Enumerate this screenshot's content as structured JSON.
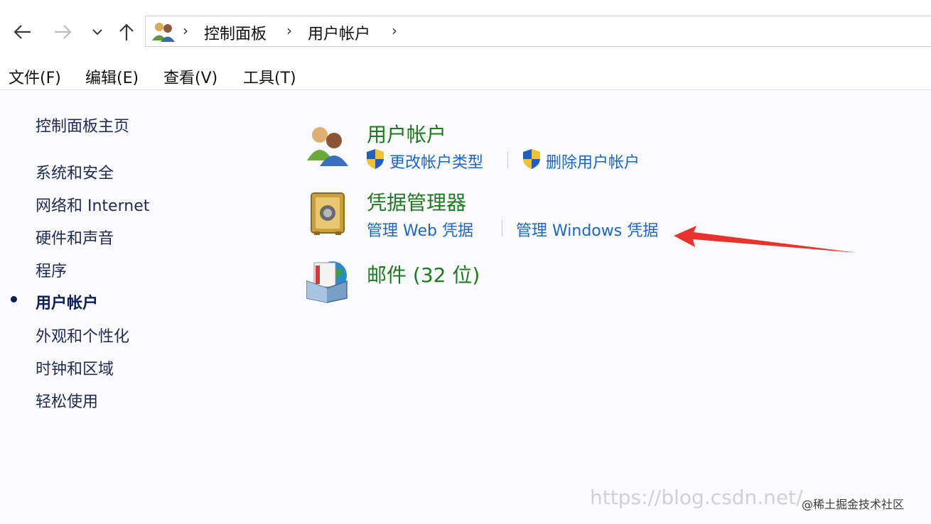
{
  "toolbar": {
    "back_icon": "arrow-left-icon",
    "forward_icon": "arrow-right-icon",
    "recent_icon": "chevron-down-icon",
    "up_icon": "arrow-up-icon"
  },
  "breadcrumb": {
    "icon": "users-icon",
    "items": [
      "控制面板",
      "用户帐户"
    ],
    "separator": "›"
  },
  "menu": {
    "items": [
      "文件(F)",
      "编辑(E)",
      "查看(V)",
      "工具(T)"
    ]
  },
  "sidebar": {
    "home": "控制面板主页",
    "items": [
      {
        "label": "系统和安全",
        "active": false
      },
      {
        "label": "网络和 Internet",
        "active": false
      },
      {
        "label": "硬件和声音",
        "active": false
      },
      {
        "label": "程序",
        "active": false
      },
      {
        "label": "用户帐户",
        "active": true
      },
      {
        "label": "外观和个性化",
        "active": false
      },
      {
        "label": "时钟和区域",
        "active": false
      },
      {
        "label": "轻松使用",
        "active": false
      }
    ]
  },
  "main": {
    "categories": [
      {
        "title": "用户帐户",
        "icon": "user-accounts-icon",
        "links": [
          {
            "label": "更改帐户类型",
            "shield": true
          },
          {
            "label": "删除用户帐户",
            "shield": true
          }
        ]
      },
      {
        "title": "凭据管理器",
        "icon": "credential-vault-icon",
        "links": [
          {
            "label": "管理 Web 凭据",
            "shield": false
          },
          {
            "label": "管理 Windows 凭据",
            "shield": false
          }
        ]
      },
      {
        "title": "邮件 (32 位)",
        "icon": "mail-icon",
        "links": []
      }
    ]
  },
  "colors": {
    "category_title": "#1e7a1e",
    "link": "#1a66c8",
    "nav_text": "#1e2a52",
    "arrow": "#e8322b"
  },
  "watermark": {
    "url": "https://blog.csdn.net/",
    "tag": "@稀土掘金技术社区"
  }
}
